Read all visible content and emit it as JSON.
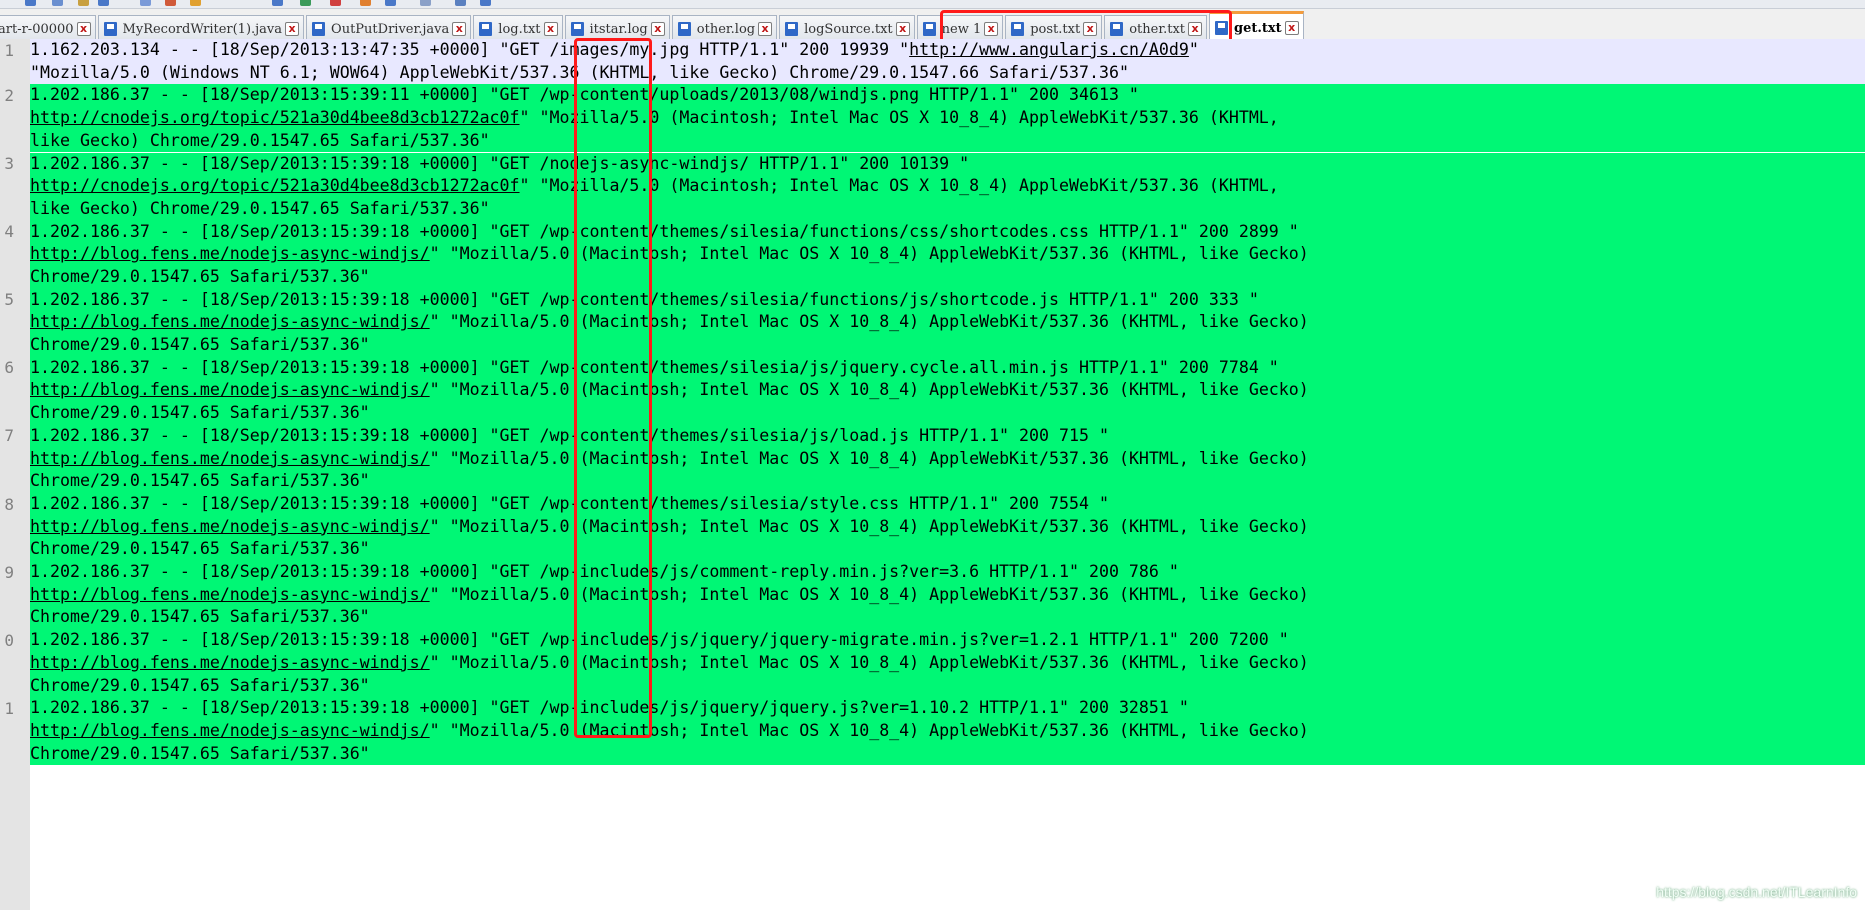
{
  "tabs": [
    {
      "label": "art-r-00000",
      "close": "x",
      "active": false,
      "has_icon": false
    },
    {
      "label": "MyRecordWriter(1).java",
      "close": "x",
      "active": false,
      "has_icon": true
    },
    {
      "label": "OutPutDriver.java",
      "close": "x",
      "active": false,
      "has_icon": true
    },
    {
      "label": "log.txt",
      "close": "x",
      "active": false,
      "has_icon": true
    },
    {
      "label": "itstar.log",
      "close": "x",
      "active": false,
      "has_icon": true
    },
    {
      "label": "other.log",
      "close": "x",
      "active": false,
      "has_icon": true
    },
    {
      "label": "logSource.txt",
      "close": "x",
      "active": false,
      "has_icon": true
    },
    {
      "label": "new 1",
      "close": "x",
      "active": false,
      "has_icon": true
    },
    {
      "label": "post.txt",
      "close": "x",
      "active": false,
      "has_icon": true
    },
    {
      "label": "other.txt",
      "close": "x",
      "active": false,
      "has_icon": true
    },
    {
      "label": "get.txt",
      "close": "x",
      "active": true,
      "has_icon": true
    }
  ],
  "editor": {
    "records": [
      {
        "number": "1",
        "current": true,
        "lines": [
          {
            "parts": [
              {
                "t": "1.162.203.134 - - [18/Sep/2013:13:47:35 +0000] \"GET /images/my.jpg HTTP/1.1\" 200 19939 \""
              },
              {
                "t": "http://www.angularjs.cn/A0d9",
                "url": true
              },
              {
                "t": "\""
              }
            ]
          },
          {
            "parts": [
              {
                "t": "\"Mozilla/5.0 (Windows NT 6.1; WOW64) AppleWebKit/537.36 (KHTML, like Gecko) Chrome/29.0.1547.66 Safari/537.36\""
              }
            ]
          }
        ]
      },
      {
        "number": "2",
        "current": false,
        "lines": [
          {
            "parts": [
              {
                "t": "1.202.186.37 - - [18/Sep/2013:15:39:11 +0000] \"GET /wp-content/uploads/2013/08/windjs.png HTTP/1.1\" 200 34613 \""
              }
            ]
          },
          {
            "parts": [
              {
                "t": "http://cnodejs.org/topic/521a30d4bee8d3cb1272ac0f",
                "url": true
              },
              {
                "t": "\" \"Mozilla/5.0 (Macintosh; Intel Mac OS X 10_8_4) AppleWebKit/537.36 (KHTML,"
              }
            ]
          },
          {
            "parts": [
              {
                "t": "like Gecko) Chrome/29.0.1547.65 Safari/537.36\""
              }
            ]
          }
        ]
      },
      {
        "number": "3",
        "current": false,
        "lines": [
          {
            "parts": [
              {
                "t": "1.202.186.37 - - [18/Sep/2013:15:39:18 +0000] \"GET /nodejs-async-windjs/ HTTP/1.1\" 200 10139 \""
              }
            ]
          },
          {
            "parts": [
              {
                "t": "http://cnodejs.org/topic/521a30d4bee8d3cb1272ac0f",
                "url": true
              },
              {
                "t": "\" \"Mozilla/5.0 (Macintosh; Intel Mac OS X 10_8_4) AppleWebKit/537.36 (KHTML,"
              }
            ]
          },
          {
            "parts": [
              {
                "t": "like Gecko) Chrome/29.0.1547.65 Safari/537.36\""
              }
            ]
          }
        ]
      },
      {
        "number": "4",
        "current": false,
        "lines": [
          {
            "parts": [
              {
                "t": "1.202.186.37 - - [18/Sep/2013:15:39:18 +0000] \"GET /wp-content/themes/silesia/functions/css/shortcodes.css HTTP/1.1\" 200 2899 \""
              }
            ]
          },
          {
            "parts": [
              {
                "t": "http://blog.fens.me/nodejs-async-windjs/",
                "url": true
              },
              {
                "t": "\" \"Mozilla/5.0 (Macintosh; Intel Mac OS X 10_8_4) AppleWebKit/537.36 (KHTML, like Gecko)"
              }
            ]
          },
          {
            "parts": [
              {
                "t": "Chrome/29.0.1547.65 Safari/537.36\""
              }
            ]
          }
        ]
      },
      {
        "number": "5",
        "current": false,
        "lines": [
          {
            "parts": [
              {
                "t": "1.202.186.37 - - [18/Sep/2013:15:39:18 +0000] \"GET /wp-content/themes/silesia/functions/js/shortcode.js HTTP/1.1\" 200 333 \""
              }
            ]
          },
          {
            "parts": [
              {
                "t": "http://blog.fens.me/nodejs-async-windjs/",
                "url": true
              },
              {
                "t": "\" \"Mozilla/5.0 (Macintosh; Intel Mac OS X 10_8_4) AppleWebKit/537.36 (KHTML, like Gecko)"
              }
            ]
          },
          {
            "parts": [
              {
                "t": "Chrome/29.0.1547.65 Safari/537.36\""
              }
            ]
          }
        ]
      },
      {
        "number": "6",
        "current": false,
        "lines": [
          {
            "parts": [
              {
                "t": "1.202.186.37 - - [18/Sep/2013:15:39:18 +0000] \"GET /wp-content/themes/silesia/js/jquery.cycle.all.min.js HTTP/1.1\" 200 7784 \""
              }
            ]
          },
          {
            "parts": [
              {
                "t": "http://blog.fens.me/nodejs-async-windjs/",
                "url": true
              },
              {
                "t": "\" \"Mozilla/5.0 (Macintosh; Intel Mac OS X 10_8_4) AppleWebKit/537.36 (KHTML, like Gecko)"
              }
            ]
          },
          {
            "parts": [
              {
                "t": "Chrome/29.0.1547.65 Safari/537.36\""
              }
            ]
          }
        ]
      },
      {
        "number": "7",
        "current": false,
        "lines": [
          {
            "parts": [
              {
                "t": "1.202.186.37 - - [18/Sep/2013:15:39:18 +0000] \"GET /wp-content/themes/silesia/js/load.js HTTP/1.1\" 200 715 \""
              }
            ]
          },
          {
            "parts": [
              {
                "t": "http://blog.fens.me/nodejs-async-windjs/",
                "url": true
              },
              {
                "t": "\" \"Mozilla/5.0 (Macintosh; Intel Mac OS X 10_8_4) AppleWebKit/537.36 (KHTML, like Gecko)"
              }
            ]
          },
          {
            "parts": [
              {
                "t": "Chrome/29.0.1547.65 Safari/537.36\""
              }
            ]
          }
        ]
      },
      {
        "number": "8",
        "current": false,
        "lines": [
          {
            "parts": [
              {
                "t": "1.202.186.37 - - [18/Sep/2013:15:39:18 +0000] \"GET /wp-content/themes/silesia/style.css HTTP/1.1\" 200 7554 \""
              }
            ]
          },
          {
            "parts": [
              {
                "t": "http://blog.fens.me/nodejs-async-windjs/",
                "url": true
              },
              {
                "t": "\" \"Mozilla/5.0 (Macintosh; Intel Mac OS X 10_8_4) AppleWebKit/537.36 (KHTML, like Gecko)"
              }
            ]
          },
          {
            "parts": [
              {
                "t": "Chrome/29.0.1547.65 Safari/537.36\""
              }
            ]
          }
        ]
      },
      {
        "number": "9",
        "current": false,
        "lines": [
          {
            "parts": [
              {
                "t": "1.202.186.37 - - [18/Sep/2013:15:39:18 +0000] \"GET /wp-includes/js/comment-reply.min.js?ver=3.6 HTTP/1.1\" 200 786 \""
              }
            ]
          },
          {
            "parts": [
              {
                "t": "http://blog.fens.me/nodejs-async-windjs/",
                "url": true
              },
              {
                "t": "\" \"Mozilla/5.0 (Macintosh; Intel Mac OS X 10_8_4) AppleWebKit/537.36 (KHTML, like Gecko)"
              }
            ]
          },
          {
            "parts": [
              {
                "t": "Chrome/29.0.1547.65 Safari/537.36\""
              }
            ]
          }
        ]
      },
      {
        "number": "0",
        "current": false,
        "lines": [
          {
            "parts": [
              {
                "t": "1.202.186.37 - - [18/Sep/2013:15:39:18 +0000] \"GET /wp-includes/js/jquery/jquery-migrate.min.js?ver=1.2.1 HTTP/1.1\" 200 7200 \""
              }
            ]
          },
          {
            "parts": [
              {
                "t": "http://blog.fens.me/nodejs-async-windjs/",
                "url": true
              },
              {
                "t": "\" \"Mozilla/5.0 (Macintosh; Intel Mac OS X 10_8_4) AppleWebKit/537.36 (KHTML, like Gecko)"
              }
            ]
          },
          {
            "parts": [
              {
                "t": "Chrome/29.0.1547.65 Safari/537.36\""
              }
            ]
          }
        ]
      },
      {
        "number": "1",
        "current": false,
        "lines": [
          {
            "parts": [
              {
                "t": "1.202.186.37 - - [18/Sep/2013:15:39:18 +0000] \"GET /wp-includes/js/jquery/jquery.js?ver=1.10.2 HTTP/1.1\" 200 32851 \""
              }
            ]
          },
          {
            "parts": [
              {
                "t": "http://blog.fens.me/nodejs-async-windjs/",
                "url": true
              },
              {
                "t": "\" \"Mozilla/5.0 (Macintosh; Intel Mac OS X 10_8_4) AppleWebKit/537.36 (KHTML, like Gecko)"
              }
            ]
          },
          {
            "parts": [
              {
                "t": "Chrome/29.0.1547.65 Safari/537.36\""
              }
            ]
          }
        ]
      }
    ]
  },
  "watermark": "https://blog.csdn.net/ITLearnInfo",
  "colors": {
    "match_highlight": "#00f775",
    "current_line": "#e8e8ff",
    "annotation_box": "#ff1a1a",
    "active_tab_accent": "#f39c3c"
  }
}
